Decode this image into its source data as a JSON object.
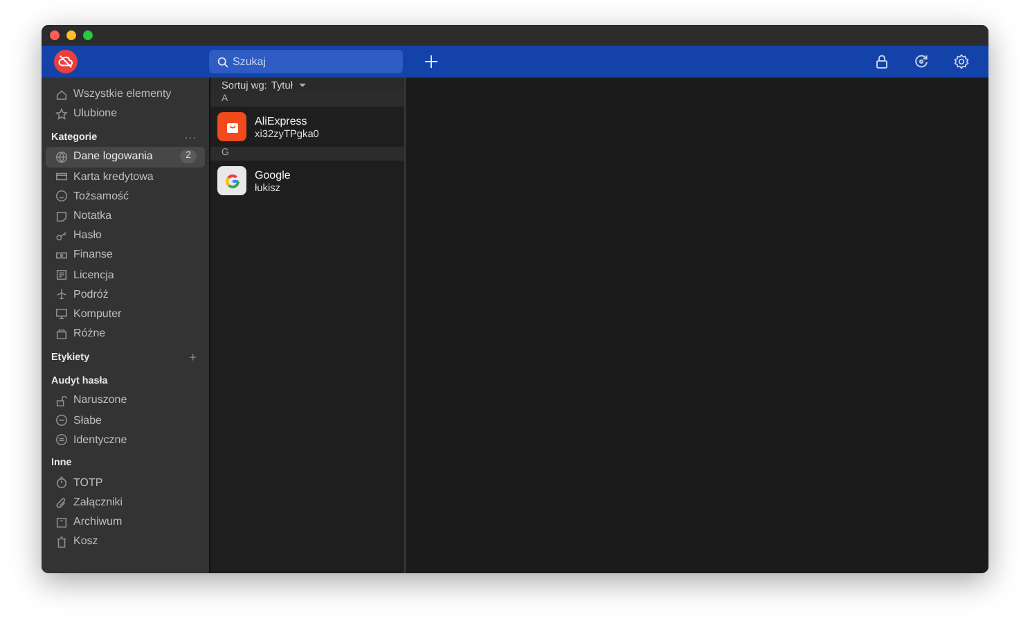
{
  "toolbar": {
    "search": {
      "placeholder": "Szukaj"
    }
  },
  "sidebar": {
    "top_items": [
      {
        "label": "Wszystkie elementy",
        "selected": false
      },
      {
        "label": "Ulubione",
        "selected": false
      }
    ],
    "sections": [
      {
        "title": "Kategorie",
        "action": "···",
        "items": [
          {
            "label": "Dane logowania",
            "selected": true,
            "count": "2"
          },
          {
            "label": "Karta kredytowa",
            "selected": false
          },
          {
            "label": "Tożsamość",
            "selected": false
          },
          {
            "label": "Notatka",
            "selected": false
          },
          {
            "label": "Hasło",
            "selected": false
          },
          {
            "label": "Finanse",
            "selected": false
          },
          {
            "label": "Licencja",
            "selected": false
          },
          {
            "label": "Podróż",
            "selected": false
          },
          {
            "label": "Komputer",
            "selected": false
          },
          {
            "label": "Różne",
            "selected": false
          }
        ]
      },
      {
        "title": "Etykiety",
        "action": "+"
      },
      {
        "title": "Audyt hasła",
        "items": [
          {
            "label": "Naruszone",
            "selected": false
          },
          {
            "label": "Słabe",
            "selected": false
          },
          {
            "label": "Identyczne",
            "selected": false
          }
        ]
      },
      {
        "title": "Inne",
        "items": [
          {
            "label": "TOTP",
            "selected": false
          },
          {
            "label": "Załączniki",
            "selected": false
          },
          {
            "label": "Archiwum",
            "selected": false
          },
          {
            "label": "Kosz",
            "selected": false
          }
        ]
      }
    ]
  },
  "list": {
    "sort_label": "Sortuj wg:",
    "sort_value": "Tytuł",
    "groups": [
      {
        "letter": "A",
        "entries": [
          {
            "title": "AliExpress",
            "subtitle": "xi32zyTPgka0",
            "kind": "bag"
          }
        ]
      },
      {
        "letter": "G",
        "entries": [
          {
            "title": "Google",
            "subtitle": "łukisz",
            "kind": "g"
          }
        ]
      }
    ]
  }
}
